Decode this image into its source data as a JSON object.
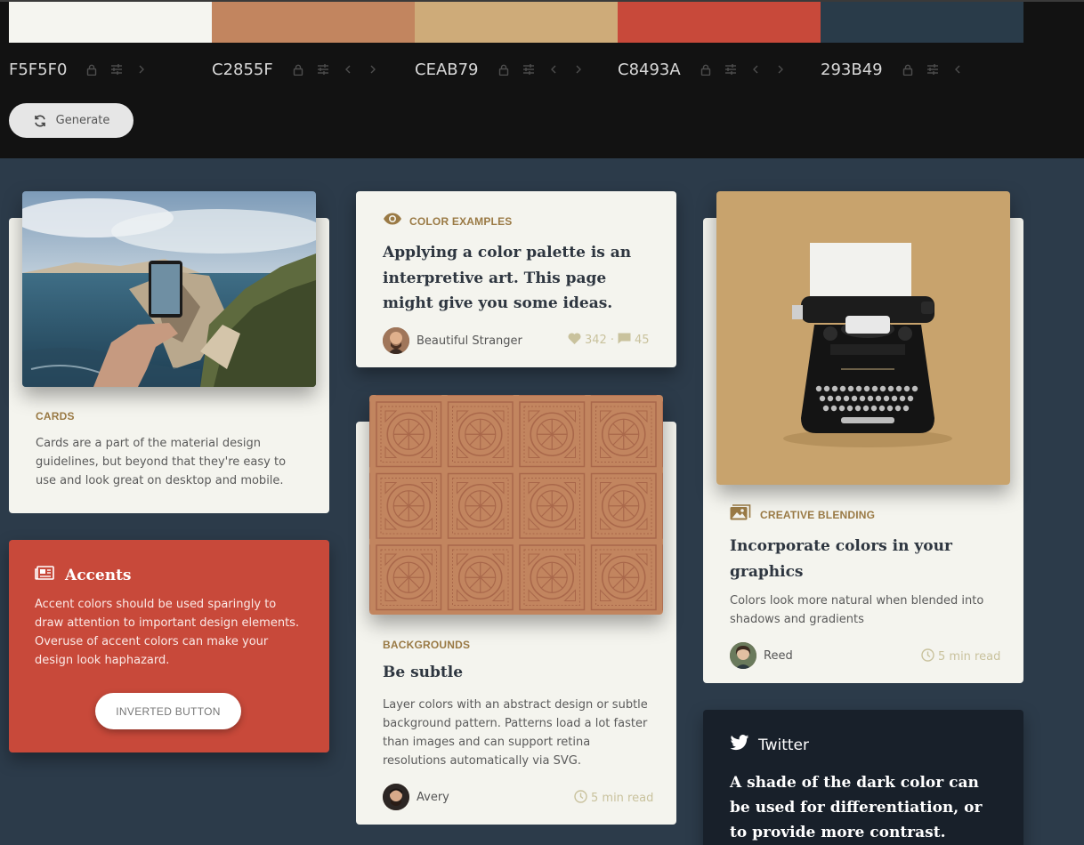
{
  "palette": [
    {
      "hex": "F5F5F0",
      "color": "#F5F5F0",
      "controls": [
        "lock-icon",
        "sliders-icon",
        "chevron-right-icon"
      ]
    },
    {
      "hex": "C2855F",
      "color": "#C2855F",
      "controls": [
        "lock-icon",
        "sliders-icon",
        "chevron-left-icon",
        "chevron-right-icon"
      ]
    },
    {
      "hex": "CEAB79",
      "color": "#CEAB79",
      "controls": [
        "lock-icon",
        "sliders-icon",
        "chevron-left-icon",
        "chevron-right-icon"
      ]
    },
    {
      "hex": "C8493A",
      "color": "#C8493A",
      "controls": [
        "lock-icon",
        "sliders-icon",
        "chevron-left-icon",
        "chevron-right-icon"
      ]
    },
    {
      "hex": "293B49",
      "color": "#293B49",
      "controls": [
        "lock-icon",
        "sliders-icon",
        "chevron-left-icon"
      ]
    }
  ],
  "generate": {
    "label": "Generate",
    "icon": "refresh-icon"
  },
  "cards_card": {
    "category": "CARDS",
    "text": "Cards are a part of the material design guidelines, but beyond that they're easy to use and look great on desktop and mobile.",
    "image": "photo-hand-holding-phone-coast"
  },
  "accents_card": {
    "title": "Accents",
    "icon": "newspaper-icon",
    "text": "Accent colors should be used sparingly to draw attention to important design elements. Overuse of accent colors can make your design look haphazard.",
    "button": "INVERTED BUTTON"
  },
  "color_examples_card": {
    "category": "COLOR EXAMPLES",
    "icon": "eye-icon",
    "title": "Applying a color palette is an interpretive art. This page might give you some ideas.",
    "author": "Beautiful Stranger",
    "likes": "342",
    "separator": "·",
    "comments": "45"
  },
  "backgrounds_card": {
    "category": "BACKGROUNDS",
    "title": "Be subtle",
    "text": "Layer colors with an abstract design or subtle background pattern. Patterns load a lot faster than images and can support retina resolutions automatically via SVG.",
    "author": "Avery",
    "read_time": "5 min read",
    "image": "tile-pattern"
  },
  "blending_card": {
    "category": "CREATIVE BLENDING",
    "icon": "images-icon",
    "title": "Incorporate colors in your graphics",
    "text": "Colors look more natural when blended into shadows and gradients",
    "author": "Reed",
    "read_time": "5 min read",
    "image": "photo-typewriter"
  },
  "twitter_card": {
    "title": "Twitter",
    "icon": "twitter-icon",
    "text": "A shade of the dark color can be used for differentiation, or to provide more contrast."
  }
}
